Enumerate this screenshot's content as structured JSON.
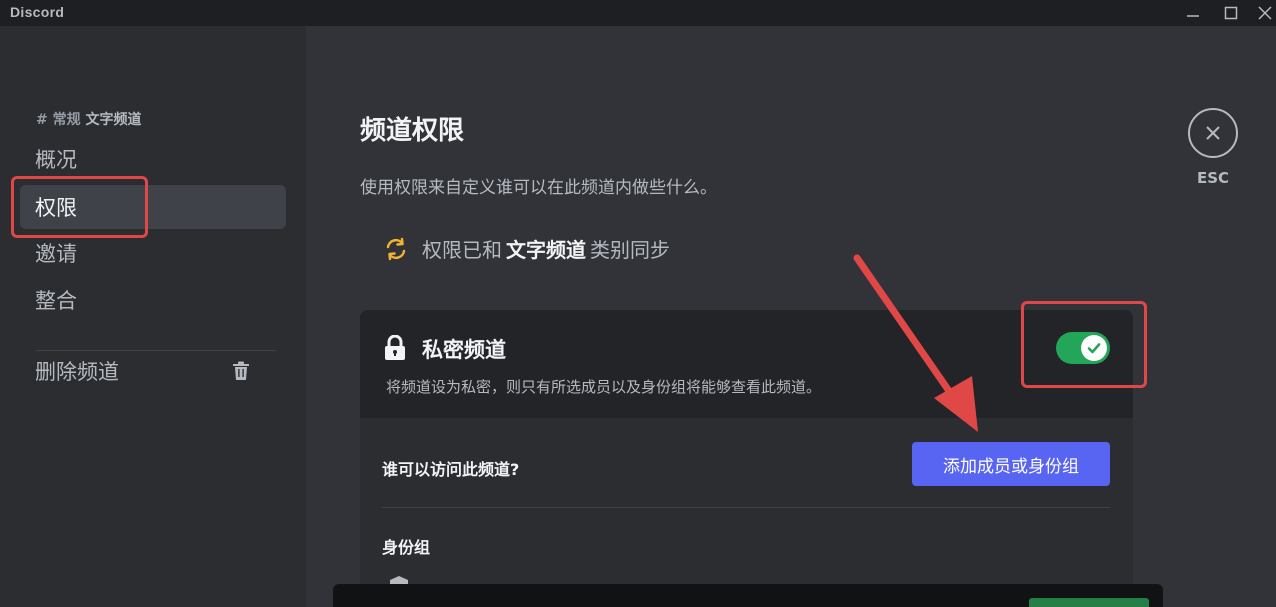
{
  "app": {
    "title": "Discord"
  },
  "sidebar": {
    "header_prefix": "# 常规",
    "header_channel": "文字频道",
    "items": [
      {
        "label": "概况",
        "active": false
      },
      {
        "label": "权限",
        "active": true
      },
      {
        "label": "邀请",
        "active": false
      },
      {
        "label": "整合",
        "active": false
      }
    ],
    "delete_label": "删除频道"
  },
  "main": {
    "title": "频道权限",
    "description": "使用权限来自定义谁可以在此频道内做些什么。",
    "sync_prefix": "权限已和",
    "sync_channel": "文字频道",
    "sync_suffix": "类别同步",
    "esc_label": "ESC"
  },
  "private_card": {
    "title": "私密频道",
    "description": "将频道设为私密，则只有所选成员以及身份组将能够查看此频道。",
    "toggle_on": true,
    "who_label": "谁可以访问此频道?",
    "add_button": "添加成员或身份组",
    "roles_label": "身份组"
  },
  "colors": {
    "accent": "#5865f2",
    "toggle_on": "#23a55a",
    "annotation": "#e04848",
    "sync_icon": "#f0b232"
  }
}
